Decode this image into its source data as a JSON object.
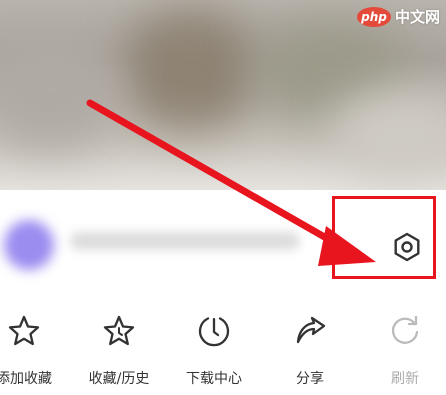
{
  "watermark": {
    "logo": "php",
    "text": "中文网"
  },
  "account": {
    "settings_icon": "settings-gear-icon"
  },
  "toolbar": {
    "items": [
      {
        "label": "添加收藏",
        "icon": "star-icon",
        "enabled": true
      },
      {
        "label": "收藏/历史",
        "icon": "star-clock-icon",
        "enabled": true
      },
      {
        "label": "下载中心",
        "icon": "download-clock-icon",
        "enabled": true
      },
      {
        "label": "分享",
        "icon": "share-icon",
        "enabled": true
      },
      {
        "label": "刷新",
        "icon": "refresh-icon",
        "enabled": false
      }
    ]
  },
  "colors": {
    "highlight": "#e8141e",
    "icon": "#333333",
    "disabled": "#aaaaaa",
    "watermark_logo_bg": "#e44a3a"
  }
}
